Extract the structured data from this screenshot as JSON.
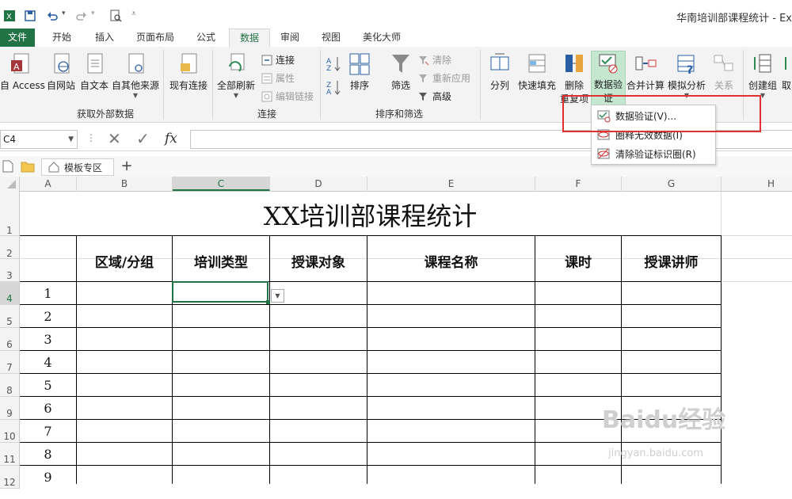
{
  "window": {
    "title": "华南培训部课程统计 - Ex"
  },
  "quick_access": {
    "icons": [
      "excel-logo-icon",
      "save-icon",
      "undo-icon",
      "redo-icon",
      "print-preview-icon",
      "customize-icon"
    ]
  },
  "tabs": [
    "文件",
    "开始",
    "插入",
    "页面布局",
    "公式",
    "数据",
    "审阅",
    "视图",
    "美化大师"
  ],
  "ribbon": {
    "external": {
      "access": "自 Access",
      "web": "自网站",
      "text": "自文本",
      "other": "自其他来源",
      "existing": "现有连接",
      "group": "获取外部数据"
    },
    "connections": {
      "refresh_all": "全部刷新",
      "connections": "连接",
      "properties": "属性",
      "edit_links": "编辑链接",
      "group": "连接"
    },
    "sort_filter": {
      "sort": "排序",
      "filter": "筛选",
      "clear": "清除",
      "reapply": "重新应用",
      "advanced": "高级",
      "group": "排序和筛选"
    },
    "tools": {
      "split": "分列",
      "flash_fill": "快速填充",
      "remove_dup_1": "删除",
      "remove_dup_2": "重复项",
      "validation_1": "数据验",
      "validation_2": "证",
      "consolidate": "合并计算",
      "whatif": "模拟分析",
      "relations": "关系"
    },
    "outline": {
      "group_btn": "创建组",
      "ungroup": "取"
    }
  },
  "dv_menu": {
    "items": [
      "数据验证(V)...",
      "圈释无效数据(I)",
      "清除验证标识圈(R)"
    ]
  },
  "formula_bar": {
    "name_box": "C4",
    "fx": "fx",
    "value": ""
  },
  "sheet_tabs": {
    "template": "模板专区",
    "add": "+"
  },
  "columns": [
    "A",
    "B",
    "C",
    "D",
    "E",
    "F",
    "G",
    "H"
  ],
  "rows": [
    "1",
    "2",
    "3",
    "4",
    "5",
    "6",
    "7",
    "8",
    "9",
    "10",
    "11",
    "12"
  ],
  "sheet": {
    "title": "XX培训部课程统计",
    "headers": [
      "区域/分组",
      "培训类型",
      "授课对象",
      "课程名称",
      "课时",
      "授课讲师"
    ],
    "numbers": [
      "1",
      "2",
      "3",
      "4",
      "5",
      "6",
      "7",
      "8",
      "9"
    ]
  },
  "watermark": {
    "main": "Baidu经验",
    "sub": "jingyan.baidu.com"
  },
  "colors": {
    "excel_green": "#217346",
    "highlight_red": "#e03030"
  }
}
